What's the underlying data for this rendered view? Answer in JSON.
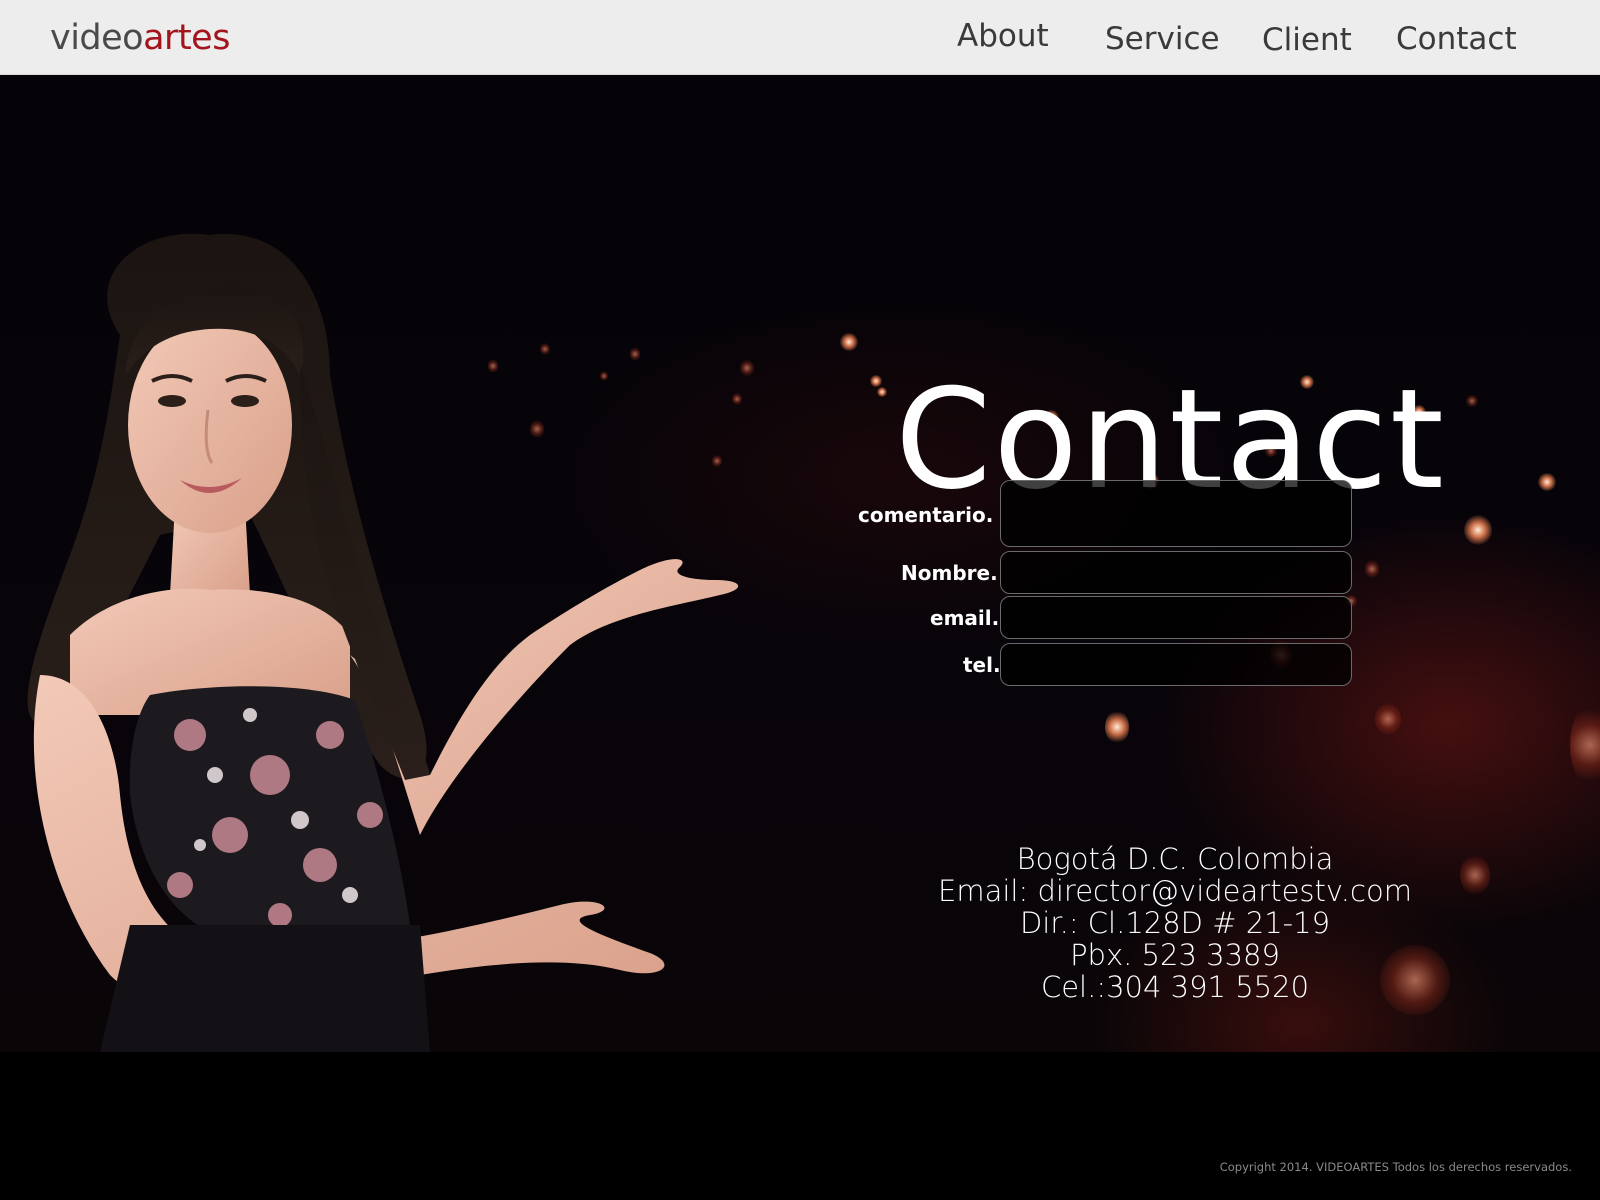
{
  "header": {
    "logo_part1": "video",
    "logo_part2": "artes",
    "nav": {
      "about": "About",
      "service": "Service",
      "client": "Client",
      "contact": "Contact"
    }
  },
  "main": {
    "title": "Contact",
    "form": {
      "comentario_label": "comentario.",
      "comentario_value": "",
      "nombre_label": "Nombre.",
      "nombre_value": "",
      "email_label": "email.",
      "email_value": "",
      "tel_label": "tel.",
      "tel_value": ""
    },
    "address": {
      "city": "Bogotá D.C. Colombia",
      "email": "Email: director@videartestv.com",
      "dir": "Dir.: Cl.128D # 21-19",
      "pbx": "Pbx. 523 3389",
      "cel": "Cel.:304 391 5520"
    }
  },
  "footer": {
    "copyright": "Copyright  2014. VIDEOARTES Todos los derechos reservados."
  },
  "colors": {
    "logo_gray": "#4a4a4a",
    "logo_red": "#a3141c",
    "topbar_bg": "#ededed",
    "page_bg": "#000000"
  },
  "icons": {
    "hero_photo": "woman-presenting-photo"
  }
}
